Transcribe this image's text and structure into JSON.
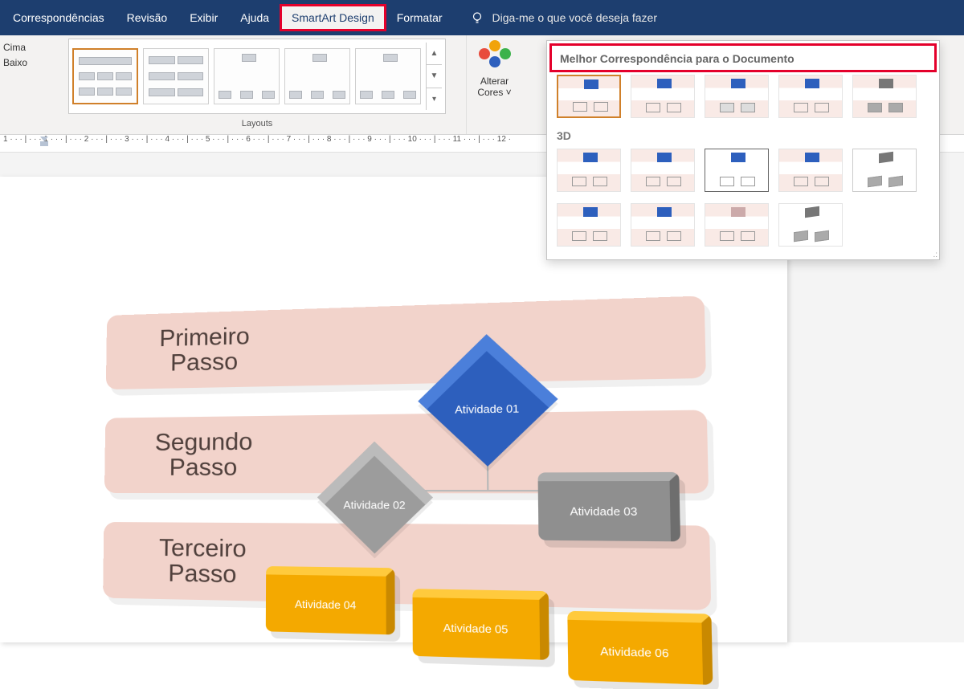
{
  "tabs": {
    "correspondencias": "Correspondências",
    "revisao": "Revisão",
    "exibir": "Exibir",
    "ajuda": "Ajuda",
    "smartart_design": "SmartArt Design",
    "formatar": "Formatar"
  },
  "tell_me": "Diga-me o que você deseja fazer",
  "create_graphic": {
    "cima": "Cima",
    "baixo": "Baixo"
  },
  "layouts": {
    "label": "Layouts"
  },
  "colors": {
    "line1": "Alterar",
    "line2": "Cores"
  },
  "styles_panel": {
    "header": "Melhor Correspondência para o Documento",
    "section_3d": "3D"
  },
  "ruler": "1 · · · | · · · 1 · · · | · · · 2 · · · | · · · 3 · · · | · · · 4 · · · | · · · 5 · · · | · · · 6 · · · | · · · 7 · · · | · · · 8 · · · | · · · 9 · · · | · · · 10 · · · | · · · 11 · · · | · · · 12 ·",
  "smartart": {
    "step1": "Primeiro Passo",
    "step2": "Segundo Passo",
    "step3": "Terceiro Passo",
    "atividade01": "Atividade 01",
    "atividade02": "Atividade 02",
    "atividade03": "Atividade 03",
    "atividade04": "Atividade 04",
    "atividade05": "Atividade 05",
    "atividade06": "Atividade 06"
  }
}
